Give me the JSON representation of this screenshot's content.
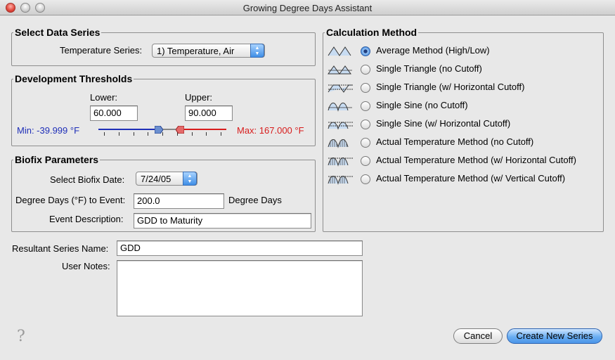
{
  "window": {
    "title": "Growing Degree Days Assistant"
  },
  "data_series": {
    "legend": "Select Data Series",
    "temperature_label": "Temperature Series:",
    "temperature_value": "1) Temperature, Air"
  },
  "thresholds": {
    "legend": "Development Thresholds",
    "lower_label": "Lower:",
    "lower_value": "60.000",
    "upper_label": "Upper:",
    "upper_value": "90.000",
    "min_text": "Min: -39.999 °F",
    "max_text": "Max: 167.000 °F",
    "lower_fraction": 0.485,
    "upper_fraction": 0.626,
    "min_color": "#1f2fb8",
    "max_color": "#d81c1c"
  },
  "biofix": {
    "legend": "Biofix Parameters",
    "date_label": "Select Biofix Date:",
    "date_value": "7/24/05",
    "dd_label": "Degree Days (°F) to Event:",
    "dd_value": "200.0",
    "dd_unit": "Degree Days",
    "desc_label": "Event Description:",
    "desc_value": "GDD to Maturity"
  },
  "calc": {
    "legend": "Calculation Method",
    "methods": [
      {
        "label": "Average Method (High/Low)",
        "checked": true,
        "icon": "average-method-icon"
      },
      {
        "label": "Single Triangle (no Cutoff)",
        "checked": false,
        "icon": "single-triangle-icon"
      },
      {
        "label": "Single Triangle (w/ Horizontal Cutoff)",
        "checked": false,
        "icon": "single-triangle-horizontal-cutoff-icon"
      },
      {
        "label": "Single Sine (no Cutoff)",
        "checked": false,
        "icon": "single-sine-icon"
      },
      {
        "label": "Single Sine (w/ Horizontal Cutoff)",
        "checked": false,
        "icon": "single-sine-horizontal-cutoff-icon"
      },
      {
        "label": "Actual Temperature Method (no Cutoff)",
        "checked": false,
        "icon": "actual-temperature-icon"
      },
      {
        "label": "Actual Temperature Method (w/ Horizontal Cutoff)",
        "checked": false,
        "icon": "actual-temperature-horizontal-cutoff-icon"
      },
      {
        "label": "Actual Temperature Method (w/ Vertical Cutoff)",
        "checked": false,
        "icon": "actual-temperature-vertical-cutoff-icon"
      }
    ]
  },
  "result": {
    "name_label": "Resultant Series Name:",
    "name_value": "GDD",
    "notes_label": "User Notes:",
    "notes_value": ""
  },
  "buttons": {
    "cancel": "Cancel",
    "create": "Create New Series",
    "help": "?"
  },
  "colors": {
    "accent": "#4b95e8",
    "window_bg": "#e8e8e8"
  }
}
